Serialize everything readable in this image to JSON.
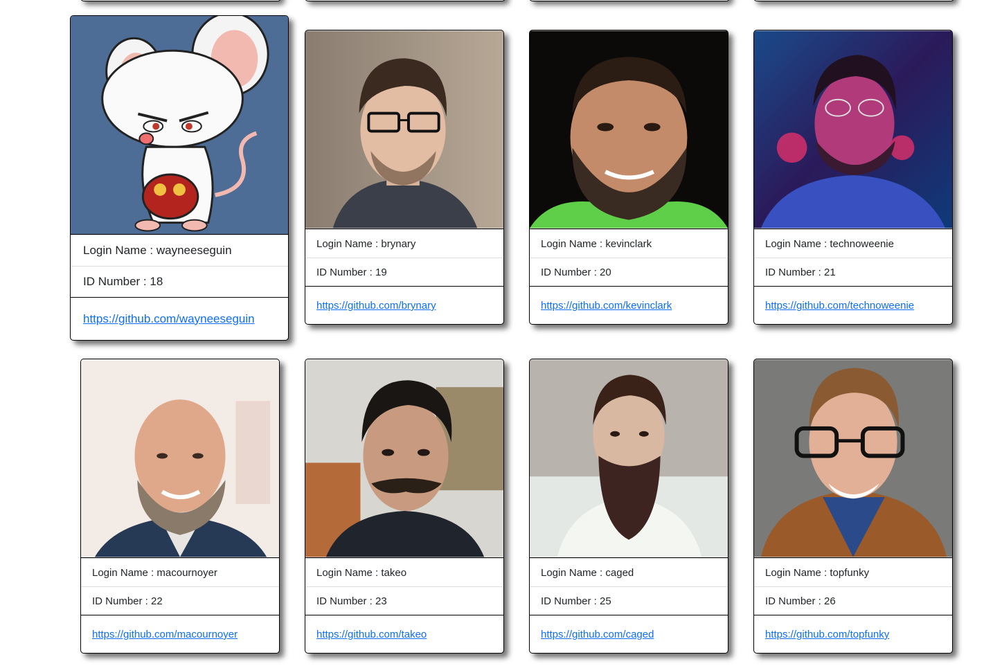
{
  "colors": {
    "link": "#0d6efd",
    "card_border": "#000000",
    "background": "#ffffff"
  },
  "labels": {
    "login_prefix": "Login Name : ",
    "id_prefix": "ID Number : "
  },
  "cards": [
    {
      "login": "wayneeseguin",
      "id": "18",
      "url": "https://github.com/wayneeseguin",
      "avatar": "cartoon-mouse-avatar",
      "zoomed": true
    },
    {
      "login": "brynary",
      "id": "19",
      "url": "https://github.com/brynary",
      "avatar": "person-photo-avatar"
    },
    {
      "login": "kevinclark",
      "id": "20",
      "url": "https://github.com/kevinclark",
      "avatar": "person-photo-avatar"
    },
    {
      "login": "technoweenie",
      "id": "21",
      "url": "https://github.com/technoweenie",
      "avatar": "person-photo-avatar"
    },
    {
      "login": "macournoyer",
      "id": "22",
      "url": "https://github.com/macournoyer",
      "avatar": "person-photo-avatar"
    },
    {
      "login": "takeo",
      "id": "23",
      "url": "https://github.com/takeo",
      "avatar": "person-photo-avatar"
    },
    {
      "login": "caged",
      "id": "25",
      "url": "https://github.com/caged",
      "avatar": "person-photo-avatar"
    },
    {
      "login": "topfunky",
      "id": "26",
      "url": "https://github.com/topfunky",
      "avatar": "person-photo-avatar"
    }
  ]
}
